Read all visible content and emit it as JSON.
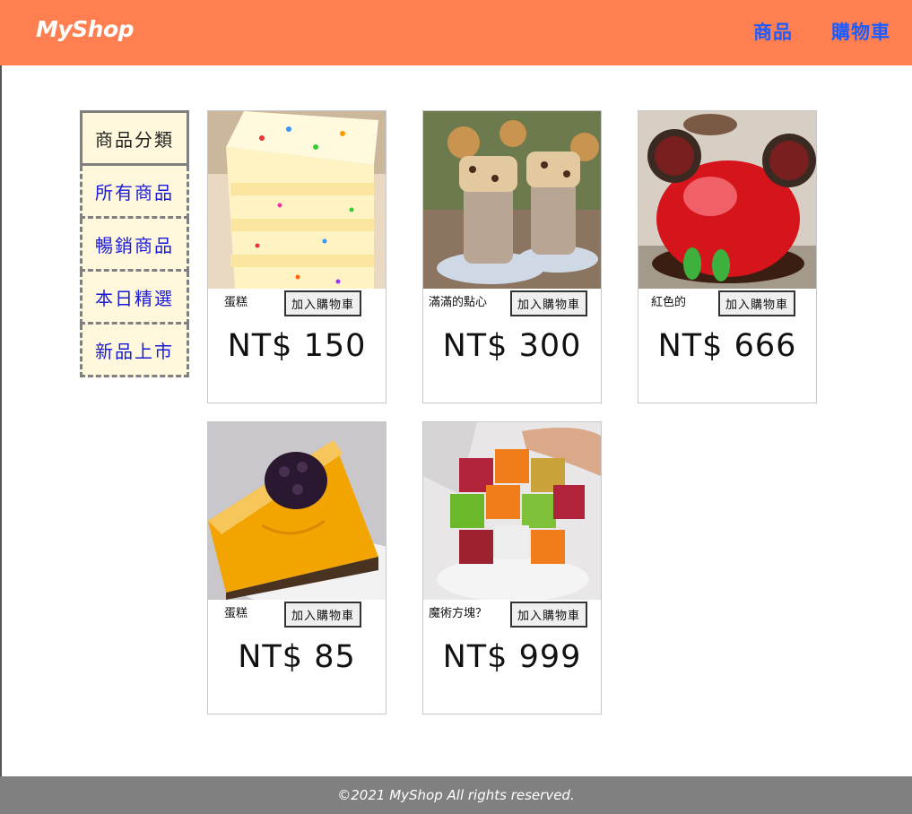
{
  "header": {
    "logo": "MyShop",
    "nav": [
      "商品",
      "購物車"
    ]
  },
  "sidebar": {
    "title": "商品分類",
    "items": [
      "所有商品",
      "暢銷商品",
      "本日精選",
      "新品上市"
    ]
  },
  "products": [
    {
      "name": "蛋糕",
      "button": "加入購物車",
      "price": "NT$ 150",
      "image": "rainbow-sprinkle-cake"
    },
    {
      "name": "滿滿的點心",
      "button": "加入購物車",
      "price": "NT$ 300",
      "image": "cookie-milkshakes"
    },
    {
      "name": "紅色的",
      "button": "加入購物車",
      "price": "NT$ 666",
      "image": "red-mickey-mousse-cake"
    },
    {
      "name": "蛋糕",
      "button": "加入購物車",
      "price": "NT$ 85",
      "image": "mango-cheesecake"
    },
    {
      "name": "魔術方塊？",
      "button": "加入購物車",
      "price": "NT$ 999",
      "image": "rubiks-cube-cake"
    }
  ],
  "footer": {
    "text": "©2021 MyShop All rights reserved."
  },
  "colors": {
    "header": "#ff7f50",
    "nav_link": "#1e5cff",
    "sidebar_bg": "#fff8dc",
    "sidebar_link": "#1a1adb",
    "footer": "#808080"
  }
}
